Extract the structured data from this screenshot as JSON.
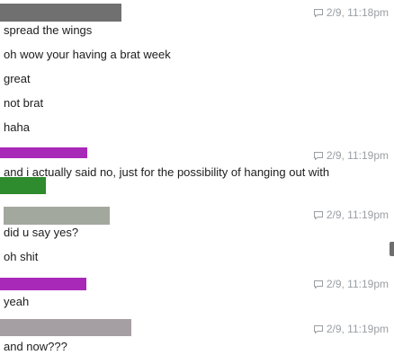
{
  "colors": {
    "sender1": "#707070",
    "sender2": "#a828b8",
    "sender2_overlay": "#2e8b2e",
    "sender3": "#a3a89f",
    "sender4": "#a828b8",
    "sender5": "#a59ea3",
    "timestamp_text": "#9a9ea3",
    "message_text": "#1c1c1c"
  },
  "icons": {
    "timestamp": "speech-bubble-icon"
  },
  "groups": [
    {
      "timestamp": "2/9, 11:18pm",
      "messages": [
        "spread the wings",
        "oh wow your having a brat week",
        "great",
        "not brat",
        "haha"
      ]
    },
    {
      "timestamp": "2/9, 11:19pm",
      "messages": [
        "and i actually said no, just for the possibility of hanging out with"
      ]
    },
    {
      "timestamp": "2/9, 11:19pm",
      "messages": [
        "did u say yes?",
        "oh shit"
      ]
    },
    {
      "timestamp": "2/9, 11:19pm",
      "messages": [
        "yeah"
      ]
    },
    {
      "timestamp": "2/9, 11:19pm",
      "messages": [
        "and now???"
      ]
    }
  ]
}
